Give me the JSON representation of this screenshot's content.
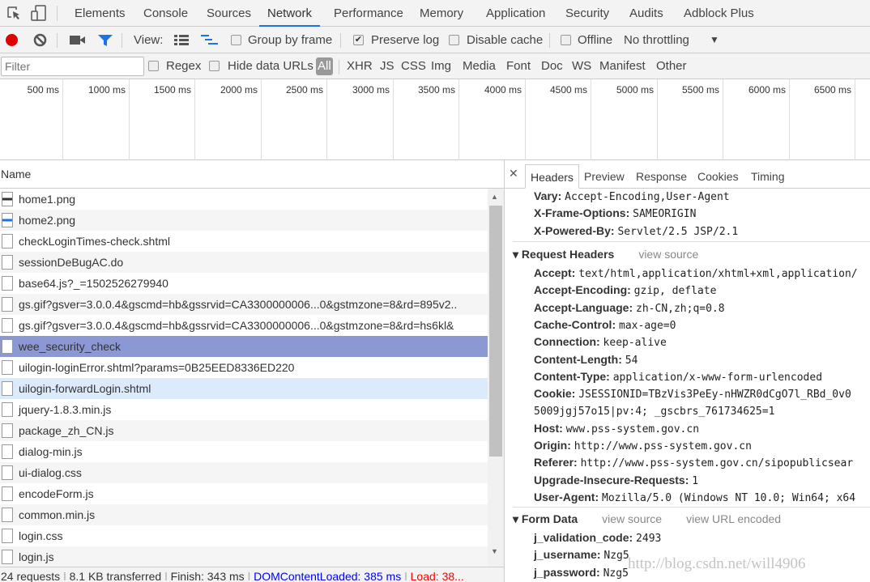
{
  "panel_tabs": [
    "Elements",
    "Console",
    "Sources",
    "Network",
    "Performance",
    "Memory",
    "Application",
    "Security",
    "Audits",
    "Adblock Plus"
  ],
  "active_panel": "Network",
  "toolbar": {
    "view_label": "View:",
    "group_by_frame": "Group by frame",
    "preserve_log": "Preserve log",
    "preserve_log_checked": true,
    "disable_cache": "Disable cache",
    "offline": "Offline",
    "throttling": "No throttling",
    "record_color": "#e00000",
    "filter_color": "#1a73e8"
  },
  "filterbar": {
    "placeholder": "Filter",
    "regex": "Regex",
    "hide_data_urls": "Hide data URLs",
    "types": [
      "All",
      "XHR",
      "JS",
      "CSS",
      "Img",
      "Media",
      "Font",
      "Doc",
      "WS",
      "Manifest",
      "Other"
    ],
    "active_type": "All"
  },
  "timeline_ticks": [
    "500 ms",
    "1000 ms",
    "1500 ms",
    "2000 ms",
    "2500 ms",
    "3000 ms",
    "3500 ms",
    "4000 ms",
    "4500 ms",
    "5000 ms",
    "5500 ms",
    "6000 ms",
    "6500 ms"
  ],
  "requests": {
    "header": "Name",
    "selected": "wee_security_check",
    "selected_color": "#8b98d3",
    "items": [
      "home1.png",
      "home2.png",
      "checkLoginTimes-check.shtml",
      "sessionDeBugAC.do",
      "base64.js?_=1502526279940",
      "gs.gif?gsver=3.0.0.4&gscmd=hb&gssrvid=CA3300000006...0&gstmzone=8&rd=895v2..",
      "gs.gif?gsver=3.0.0.4&gscmd=hb&gssrvid=CA3300000006...0&gstmzone=8&rd=hs6kl&",
      "wee_security_check",
      "uilogin-loginError.shtml?params=0B25EED8336ED220",
      "uilogin-forwardLogin.shtml",
      "jquery-1.8.3.min.js",
      "package_zh_CN.js",
      "dialog-min.js",
      "ui-dialog.css",
      "encodeForm.js",
      "common.min.js",
      "login.css",
      "login.js"
    ]
  },
  "status": {
    "requests": "24 requests",
    "transferred": "8.1 KB transferred",
    "finish": "Finish: 343 ms",
    "dcl": "DOMContentLoaded: 385 ms",
    "load": "Load: 38...",
    "dcl_color": "#0000ff",
    "load_color": "#ff0000"
  },
  "details": {
    "tabs": [
      "Headers",
      "Preview",
      "Response",
      "Cookies",
      "Timing"
    ],
    "active_tab": "Headers",
    "response_headers": [
      {
        "k": "Vary:",
        "v": "Accept-Encoding,User-Agent"
      },
      {
        "k": "X-Frame-Options:",
        "v": "SAMEORIGIN"
      },
      {
        "k": "X-Powered-By:",
        "v": "Servlet/2.5 JSP/2.1"
      }
    ],
    "request_title": "Request Headers",
    "view_source": "view source",
    "view_url_encoded": "view URL encoded",
    "request_headers": [
      {
        "k": "Accept:",
        "v": "text/html,application/xhtml+xml,application/"
      },
      {
        "k": "Accept-Encoding:",
        "v": "gzip, deflate"
      },
      {
        "k": "Accept-Language:",
        "v": "zh-CN,zh;q=0.8"
      },
      {
        "k": "Cache-Control:",
        "v": "max-age=0"
      },
      {
        "k": "Connection:",
        "v": "keep-alive"
      },
      {
        "k": "Content-Length:",
        "v": "54"
      },
      {
        "k": "Content-Type:",
        "v": "application/x-www-form-urlencoded"
      },
      {
        "k": "Cookie:",
        "v": "JSESSIONID=TBzVis3PeEy-nHWZR0dCgO7l_RBd_0v0"
      },
      {
        "k": "",
        "v": "5009jgj57o15|pv:4; _gscbrs_761734625=1"
      },
      {
        "k": "Host:",
        "v": "www.pss-system.gov.cn"
      },
      {
        "k": "Origin:",
        "v": "http://www.pss-system.gov.cn"
      },
      {
        "k": "Referer:",
        "v": "http://www.pss-system.gov.cn/sipopublicsear"
      },
      {
        "k": "Upgrade-Insecure-Requests:",
        "v": "1"
      },
      {
        "k": "User-Agent:",
        "v": "Mozilla/5.0 (Windows NT 10.0; Win64; x64"
      }
    ],
    "form_title": "Form Data",
    "form_data": [
      {
        "k": "j_validation_code:",
        "v": "2493"
      },
      {
        "k": "j_username:",
        "v": "Nzg5"
      },
      {
        "k": "j_password:",
        "v": "Nzg5"
      }
    ]
  },
  "watermark": "http://blog.csdn.net/will4906"
}
